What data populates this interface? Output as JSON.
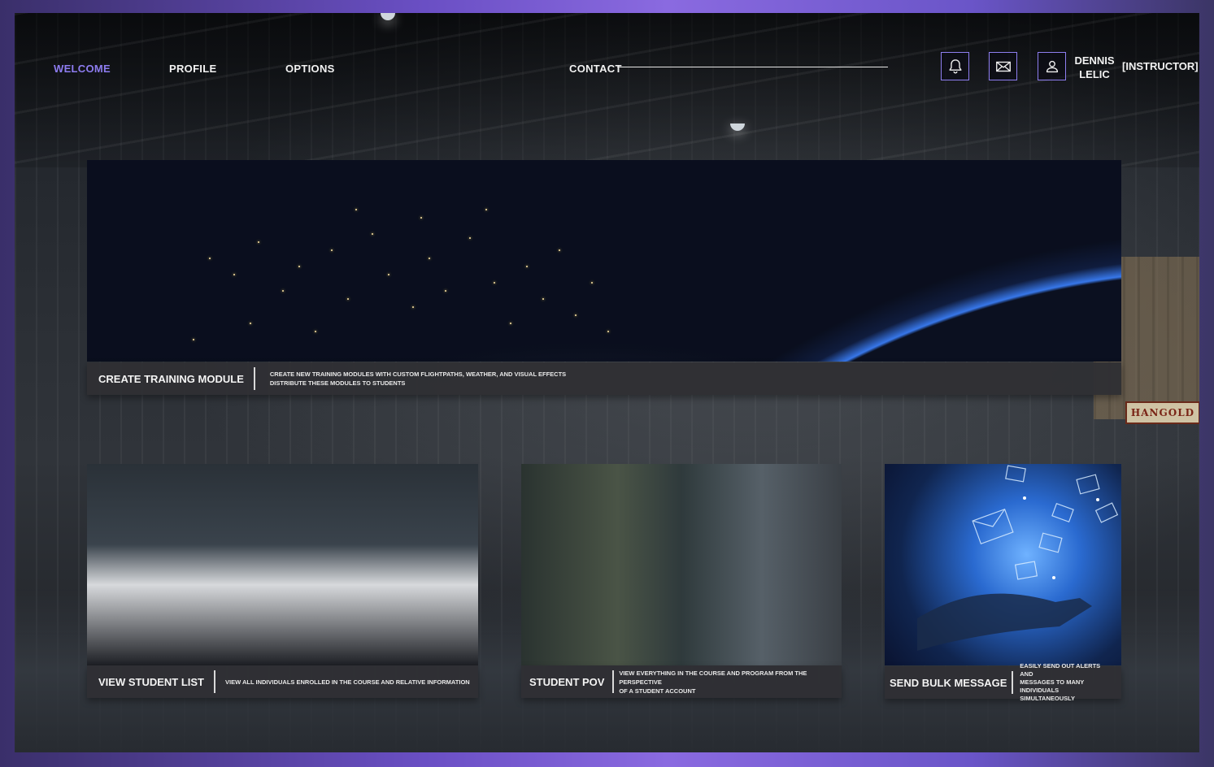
{
  "nav": {
    "welcome": "WELCOME",
    "profile": "PROFILE",
    "options": "OPTIONS",
    "contact": "CONTACT"
  },
  "header": {
    "notifications_icon": "bell-icon",
    "messages_icon": "envelope-icon",
    "profile_icon": "user-icon",
    "user_first_name": "DENNIS",
    "user_last_name": "LELIC",
    "user_role": "[INSTRUCTOR]"
  },
  "background_sign": "HANGOLD",
  "cards": {
    "create_module": {
      "title": "CREATE TRAINING MODULE",
      "desc_line1": "CREATE NEW TRAINING MODULES WITH CUSTOM FLIGHTPATHS, WEATHER, AND VISUAL EFFECTS",
      "desc_line2": "DISTRIBUTE THESE MODULES TO STUDENTS"
    },
    "student_list": {
      "title": "VIEW STUDENT LIST",
      "desc": "VIEW ALL INDIVIDUALS ENROLLED IN THE COURSE AND RELATIVE INFORMATION"
    },
    "student_pov": {
      "title": "STUDENT POV",
      "desc_line1": "VIEW EVERYTHING IN THE COURSE AND PROGRAM FROM THE PERSPECTIVE",
      "desc_line2": "OF A STUDENT ACCOUNT"
    },
    "bulk_message": {
      "title": "SEND BULK MESSAGE",
      "desc_line1": "EASILY SEND OUT ALERTS AND",
      "desc_line2": "MESSAGES TO MANY INDIVIDUALS",
      "desc_line3": "SIMULTANEOUSLY"
    }
  },
  "colors": {
    "accent": "#8d7cf0",
    "frame_gradient": "#6a4fc4",
    "card_bar": "#303034"
  }
}
